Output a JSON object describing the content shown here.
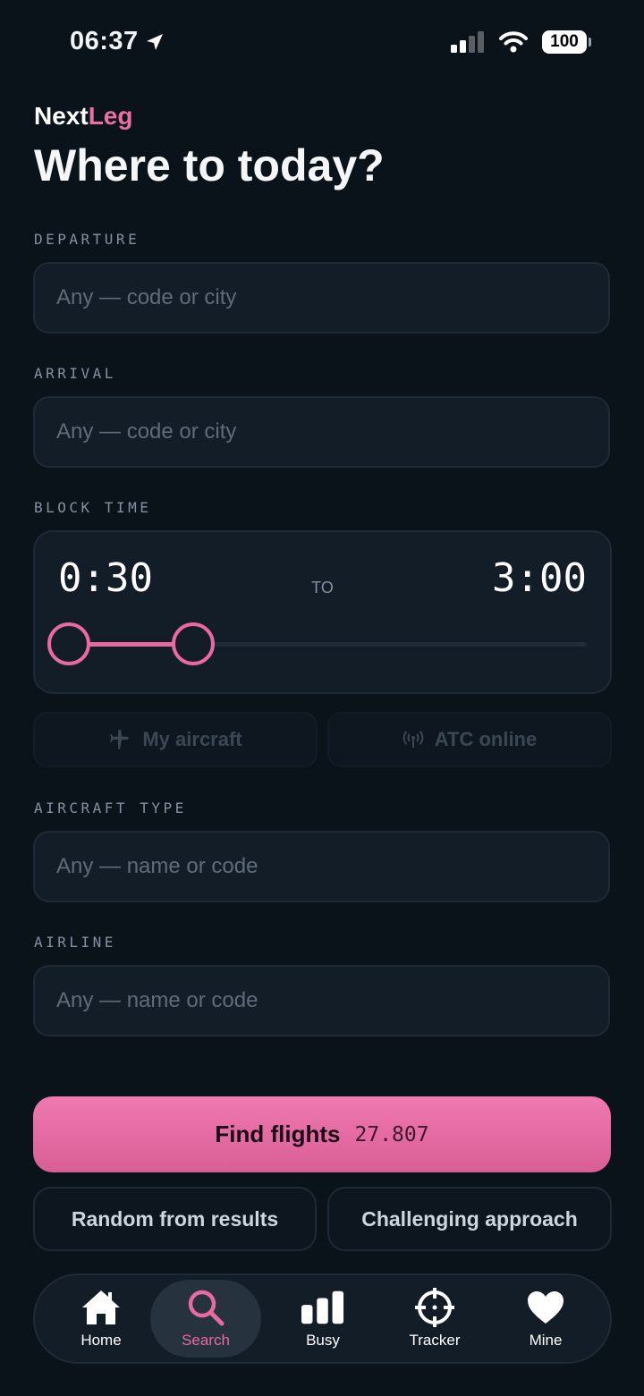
{
  "status_bar": {
    "time": "06:37",
    "battery": "100"
  },
  "brand": {
    "part1": "Next",
    "part2": "Leg"
  },
  "page_title": "Where to today?",
  "departure": {
    "label": "DEPARTURE",
    "placeholder": "Any — code or city",
    "value": ""
  },
  "arrival": {
    "label": "ARRIVAL",
    "placeholder": "Any — code or city",
    "value": ""
  },
  "block_time": {
    "label": "BLOCK TIME",
    "min": "0:30",
    "to_label": "TO",
    "max": "3:00",
    "range_min_fraction": 0.0,
    "range_max_fraction": 0.24
  },
  "toggles": {
    "my_aircraft": "My aircraft",
    "atc_online": "ATC online"
  },
  "aircraft_type": {
    "label": "AIRCRAFT TYPE",
    "placeholder": "Any — name or code",
    "value": ""
  },
  "airline": {
    "label": "AIRLINE",
    "placeholder": "Any — name or code",
    "value": ""
  },
  "find": {
    "label": "Find flights",
    "count": "27.807"
  },
  "secondary": {
    "random": "Random from results",
    "challenging": "Challenging approach"
  },
  "tabs": [
    {
      "label": "Home",
      "icon": "home-icon"
    },
    {
      "label": "Search",
      "icon": "search-icon",
      "active": true
    },
    {
      "label": "Busy",
      "icon": "bar-chart-icon"
    },
    {
      "label": "Tracker",
      "icon": "crosshair-icon"
    },
    {
      "label": "Mine",
      "icon": "heart-icon"
    }
  ],
  "colors": {
    "accent": "#e96aa1",
    "background": "#0a121a",
    "card": "#131d28"
  }
}
